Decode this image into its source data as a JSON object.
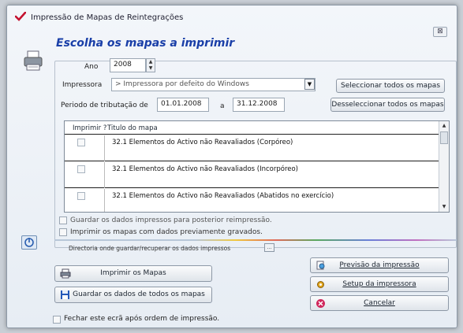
{
  "window": {
    "title": "Impressão de Mapas de Reintegrações",
    "close_label": "⊠"
  },
  "header": {
    "title": "Escolha os mapas a imprimir"
  },
  "form": {
    "year_label": "Ano",
    "year_value": "2008",
    "printer_label": "Impressora",
    "printer_value": "> Impressora por defeito do Windows",
    "period_label": "Periodo de tributação de",
    "period_from": "01.01.2008",
    "period_to_label": "a",
    "period_to": "31.12.2008"
  },
  "buttons": {
    "select_all": "Seleccionar todos os mapas",
    "deselect_all": "Desseleccionar todos os mapas",
    "print_maps": "Imprimir os Mapas",
    "save_all": "Guardar os dados de todos os mapas",
    "preview": "Previsão da impressão",
    "setup_printer": "Setup da impressora",
    "cancel": "Cancelar"
  },
  "table": {
    "columns": [
      "Imprimir ?",
      "Titulo do mapa"
    ],
    "rows": [
      {
        "title": "32.1 Elementos do Activo não Reavaliados (Corpóreo)"
      },
      {
        "title": "32.1 Elementos do Activo não Reavaliados (Incorpóreo)"
      },
      {
        "title": "32.1 Elementos do Activo não Reavaliados (Abatidos no exercício)"
      }
    ]
  },
  "options": {
    "save_for_reprint": "Guardar os dados impressos para posterior reimpressão.",
    "print_saved": "Imprimir os mapas com dados previamente gravados.",
    "directory_label": "Directoria onde guardar/recuperar os dados impressos",
    "close_after_print": "Fechar este ecrã após ordem de impressão."
  },
  "icons": {
    "app": "red-check-icon",
    "printer": "printer-icon",
    "side": "power-icon",
    "print": "printer-small-icon",
    "save": "floppy-icon",
    "preview": "magnifier-icon",
    "setup": "gear-icon",
    "cancel": "cancel-icon"
  },
  "colors": {
    "heading": "#1a3fa8",
    "cancel_icon": "#d0265c"
  }
}
